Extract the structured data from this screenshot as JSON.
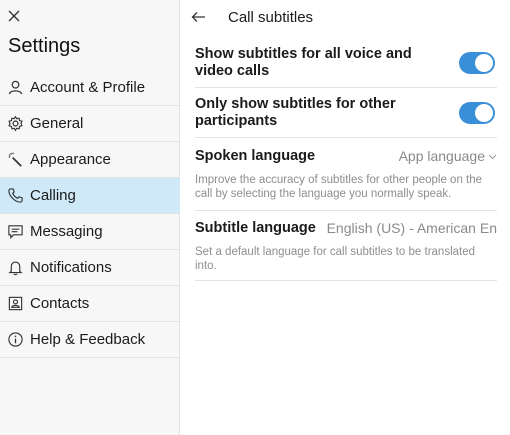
{
  "sidebar": {
    "title": "Settings",
    "items": [
      {
        "label": "Account & Profile",
        "icon": "person-icon"
      },
      {
        "label": "General",
        "icon": "gear-icon"
      },
      {
        "label": "Appearance",
        "icon": "magic-wand-icon"
      },
      {
        "label": "Calling",
        "icon": "phone-icon",
        "active": true
      },
      {
        "label": "Messaging",
        "icon": "message-icon"
      },
      {
        "label": "Notifications",
        "icon": "bell-icon"
      },
      {
        "label": "Contacts",
        "icon": "contact-card-icon"
      },
      {
        "label": "Help & Feedback",
        "icon": "info-icon"
      }
    ]
  },
  "header": {
    "title": "Call subtitles"
  },
  "settings": {
    "show_all": {
      "label": "Show subtitles for all voice and video calls",
      "on": true
    },
    "others_only": {
      "label": "Only show subtitles for other participants",
      "on": true
    },
    "spoken_language": {
      "label": "Spoken language",
      "value": "App language",
      "description": "Improve the accuracy of subtitles for other people on the call by selecting the language you normally speak."
    },
    "subtitle_language": {
      "label": "Subtitle language",
      "value": "English (US) - American En",
      "description": "Set a default language for call subtitles to be translated into."
    }
  },
  "colors": {
    "accent": "#3a8fd9",
    "active_bg": "#cfe9f8"
  }
}
